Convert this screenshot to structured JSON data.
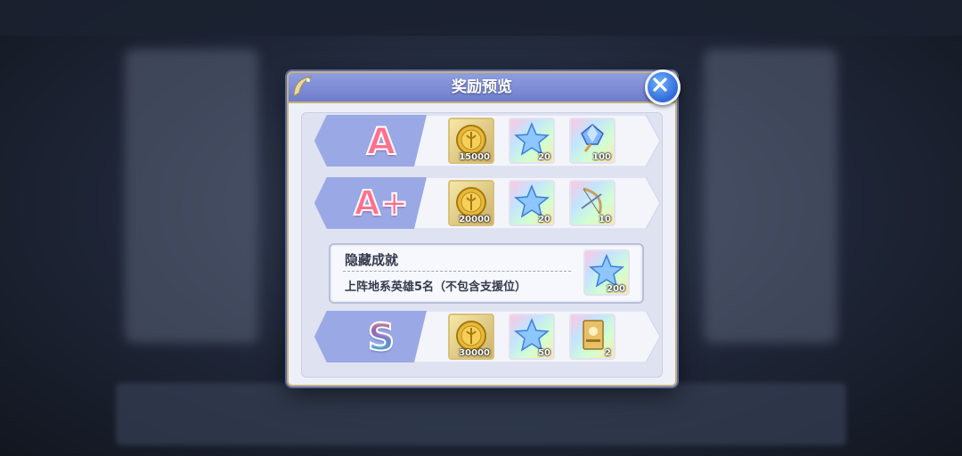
{
  "modal": {
    "title": "奖励预览",
    "close_icon": "close-x-icon"
  },
  "tiers": [
    {
      "grade": "A",
      "rewards": [
        {
          "icon": "gold-coin-icon",
          "count": "15000"
        },
        {
          "icon": "blue-star-icon",
          "count": "20"
        },
        {
          "icon": "crystal-gem-icon",
          "count": "100"
        }
      ]
    },
    {
      "grade": "A+",
      "rewards": [
        {
          "icon": "gold-coin-icon",
          "count": "20000"
        },
        {
          "icon": "blue-star-icon",
          "count": "20"
        },
        {
          "icon": "bow-weapon-icon",
          "count": "10"
        }
      ]
    },
    {
      "grade": "S",
      "rewards": [
        {
          "icon": "gold-coin-icon",
          "count": "30000"
        },
        {
          "icon": "blue-star-icon",
          "count": "50"
        },
        {
          "icon": "gold-card-icon",
          "count": "2"
        }
      ]
    }
  ],
  "hidden_achievement": {
    "title": "隐藏成就",
    "description": "上阵地系英雄5名（不包含支援位）",
    "reward": {
      "icon": "blue-star-icon",
      "count": "200"
    }
  },
  "colors": {
    "header": "#7b89d6",
    "border_gold": "#c8b27a",
    "close_button": "#2f6ad8"
  }
}
